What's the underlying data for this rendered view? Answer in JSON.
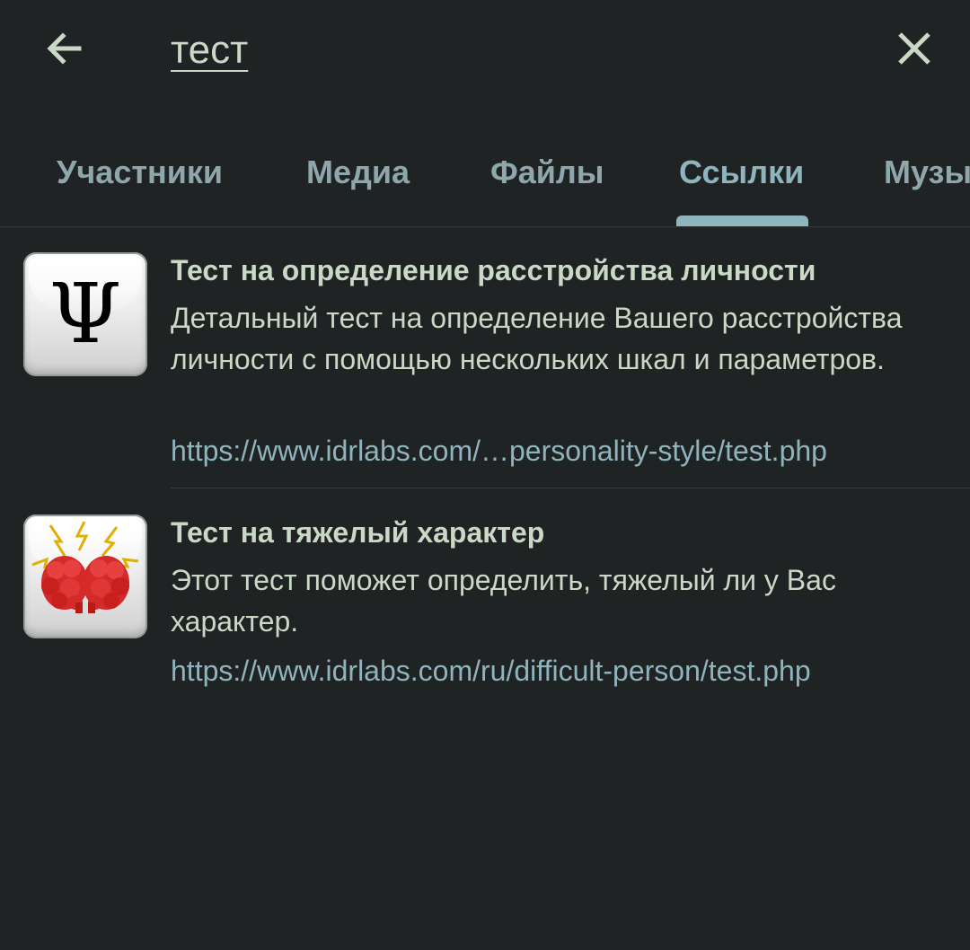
{
  "search": {
    "query": "тест"
  },
  "tabs": [
    {
      "label": "Участники"
    },
    {
      "label": "Медиа"
    },
    {
      "label": "Файлы"
    },
    {
      "label": "Ссылки",
      "active": true
    },
    {
      "label": "Музыка"
    }
  ],
  "results": [
    {
      "title": "Тест на определение расстройства личности",
      "description": "Детальный тест на определение Вашего расстройства личности с помощью нескольких шкал и параметров.",
      "url": "https://www.idrlabs.com/…personality-style/test.php",
      "thumbnail_icon": "psi-icon"
    },
    {
      "title": "Тест на тяжелый характер",
      "description": "Этот тест поможет определить, тяжелый ли у Вас характер.",
      "url": "https://www.idrlabs.com/ru/difficult-person/test.php",
      "thumbnail_icon": "brain-lightning-icon"
    }
  ],
  "icons": {
    "back": "arrow-left-icon",
    "close": "close-icon"
  },
  "colors": {
    "background": "#1f2324",
    "text": "#c9d9c6",
    "accent": "#8fb4bd",
    "tab_inactive": "#8fa7aa"
  }
}
